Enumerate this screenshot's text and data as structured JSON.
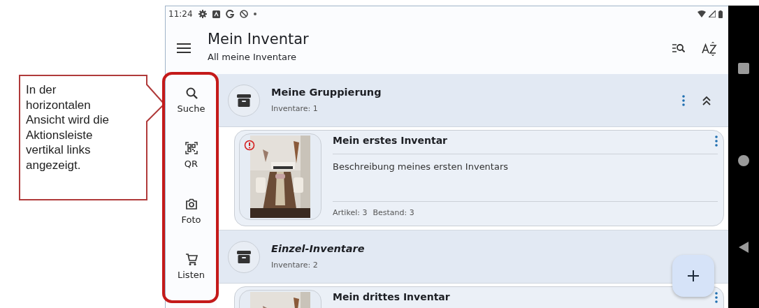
{
  "annotation": {
    "text": "In der horizontalen Ansicht wird die Aktionsleiste vertikal links angezeigt."
  },
  "status_bar": {
    "time": "11:24"
  },
  "app_bar": {
    "title": "Mein Inventar",
    "subtitle": "All meine Inventare"
  },
  "action_rail": [
    {
      "label": "Suche",
      "kind": "search"
    },
    {
      "label": "QR",
      "kind": "qr"
    },
    {
      "label": "Foto",
      "kind": "camera"
    },
    {
      "label": "Listen",
      "kind": "cart"
    }
  ],
  "groups": [
    {
      "title": "Meine Gruppierung",
      "italic": false,
      "count": "Inventare: 1",
      "collapsed": false,
      "inventories": [
        {
          "title": "Mein erstes Inventar",
          "description": "Beschreibung meines ersten Inventars",
          "stats": [
            "Artikel: 3",
            "Bestand: 3"
          ],
          "warning": true,
          "kind": "picture"
        }
      ]
    },
    {
      "title": "Einzel-Inventare",
      "italic": true,
      "count": "Inventare: 2",
      "inventories": [
        {
          "title": "Mein drittes Inventar",
          "warning": false,
          "kind": "picture"
        }
      ]
    }
  ]
}
